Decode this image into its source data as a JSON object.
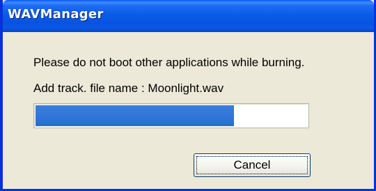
{
  "window": {
    "title": "WAVManager"
  },
  "dialog": {
    "message_1": "Please do not boot other applications while burning.",
    "message_2": "Add track.  file name : Moonlight.wav"
  },
  "progress": {
    "fraction": 0.73
  },
  "buttons": {
    "cancel_label": "Cancel"
  },
  "colors": {
    "titlebar": "#0a5ce8",
    "window_body": "#ece9d8",
    "progress_fill": "#3176d8"
  }
}
